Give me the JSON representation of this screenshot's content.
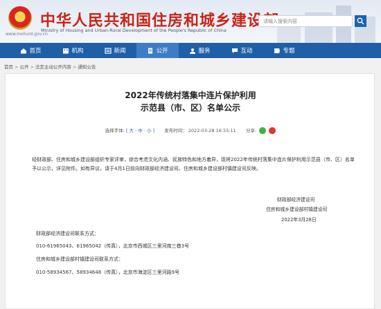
{
  "header": {
    "title": "中华人民共和国住房和城乡建设部",
    "subtitle": "Ministry of Housing and Urban-Rural Development of the People's Republic of China",
    "url": "www.mohurd.gov.cn",
    "search_placeholder": "请输入搜索内容"
  },
  "nav": {
    "items": [
      {
        "label": "首页",
        "icon": "home-icon"
      },
      {
        "label": "机构",
        "icon": "building-icon"
      },
      {
        "label": "新闻",
        "icon": "news-icon"
      },
      {
        "label": "公开",
        "icon": "document-icon",
        "active": true
      },
      {
        "label": "服务",
        "icon": "service-icon"
      },
      {
        "label": "互动",
        "icon": "interaction-icon"
      },
      {
        "label": "专题",
        "icon": "topic-icon"
      }
    ]
  },
  "breadcrumb": [
    "首页",
    "公开",
    "法定主动公开内容",
    "通知公告"
  ],
  "article": {
    "title_line1": "2022年传统村落集中连片保护利用",
    "title_line2": "示范县（市、区）名单公示",
    "font_label": "选择字体:",
    "font_options": "[ 大 · 中 · 小 ]",
    "time_label": "发布时间：",
    "time_value": "2022-03-28 16:55:11",
    "share_label": "分享:",
    "body": "经财政部、住房和城乡建设部组织专家评审，综合考虑文化内涵、民族特色和地方着异，现将2022年传统村落集中连片保护利用示范县（市、区）名单予以公示，详见附件。如有异议，请于4月1日前向财政部经济建设司、住房和城乡建设部村镇建设司反映。",
    "signature": {
      "org1": "财政部经济建设司",
      "org2": "住房和城乡建设部村镇建设司",
      "date": "2022年3月28日"
    },
    "contacts": [
      "财政部经济建设司联系方式：",
      "010-61965043、61965042（传真），北京市西城区三里河南三巷3号",
      "住房和城乡建设部村镇建设司联系方式：",
      "010-58934567、58934648（传真），北京市海淀区三里河路9号"
    ]
  },
  "colors": {
    "brand_red": "#c8251a",
    "nav_blue": "#1f5fa8",
    "nav_active": "#3f7cc6"
  }
}
